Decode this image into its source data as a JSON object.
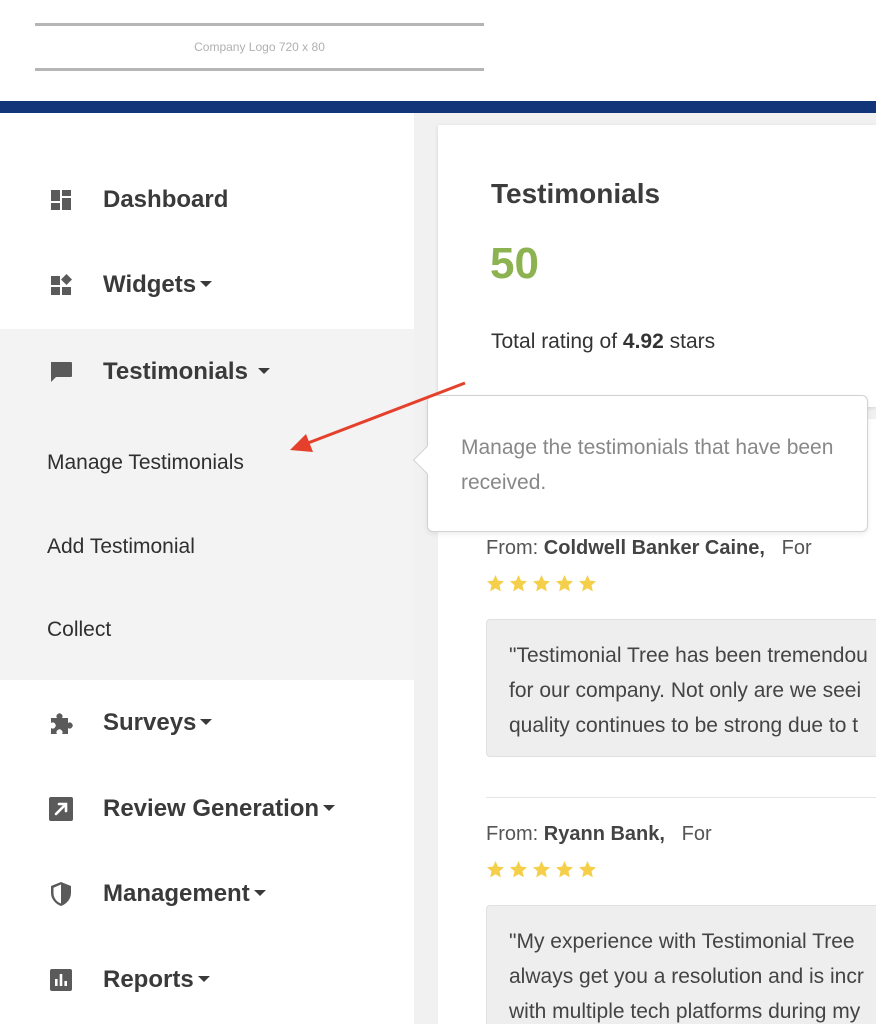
{
  "header": {
    "logo_text": "Company Logo 720 x 80"
  },
  "sidebar": {
    "items": [
      {
        "label": "Dashboard",
        "icon": "dashboard-icon"
      },
      {
        "label": "Widgets",
        "icon": "widgets-icon"
      },
      {
        "label": "Testimonials",
        "icon": "chat-bubble-icon"
      },
      {
        "label": "Surveys",
        "icon": "puzzle-icon"
      },
      {
        "label": "Review Generation",
        "icon": "external-link-icon"
      },
      {
        "label": "Management",
        "icon": "shield-icon"
      },
      {
        "label": "Reports",
        "icon": "bar-chart-icon"
      }
    ],
    "testimonials_submenu": [
      {
        "label": "Manage Testimonials"
      },
      {
        "label": "Add Testimonial"
      },
      {
        "label": "Collect"
      }
    ]
  },
  "summary": {
    "title": "Testimonials",
    "count": "50",
    "rating_prefix": "Total rating of ",
    "rating_value": "4.92",
    "rating_suffix": " stars"
  },
  "tooltip": {
    "text": "Manage the testimonials that have been received."
  },
  "testimonials": [
    {
      "from_label": "From:",
      "name": "Coldwell Banker Caine,",
      "for_label": "For",
      "stars": 5,
      "quote_lines": [
        "\"Testimonial Tree has been tremendou",
        "for our company. Not only are we seei",
        "quality continues to be strong due to t"
      ]
    },
    {
      "from_label": "From:",
      "name": "Ryann Bank,",
      "for_label": "For",
      "stars": 5,
      "quote_lines": [
        "\"My experience with Testimonial Tree",
        "always get you a resolution and is incr",
        "with multiple tech platforms during my"
      ]
    }
  ],
  "colors": {
    "navbar": "#12357a",
    "count_green": "#8db351",
    "star_yellow": "#f5cf4a",
    "annotation_red": "#e5402b"
  }
}
